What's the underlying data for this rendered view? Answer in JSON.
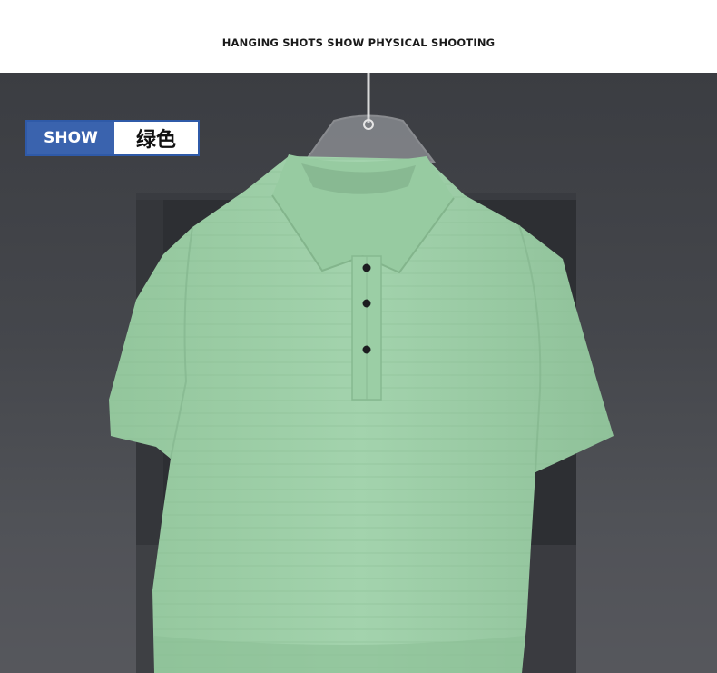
{
  "header": {
    "title": "HANGING SHOTS SHOW PHYSICAL SHOOTING"
  },
  "badge": {
    "show_label": "SHOW",
    "color_name": "绿色"
  },
  "product": {
    "item": "short-sleeve polo shirt",
    "shirt_color": "#9ed0a8",
    "button_color": "#1c1d20",
    "background_color": "#45474c"
  },
  "icons": {
    "hanger": "clothes-hanger-icon"
  }
}
